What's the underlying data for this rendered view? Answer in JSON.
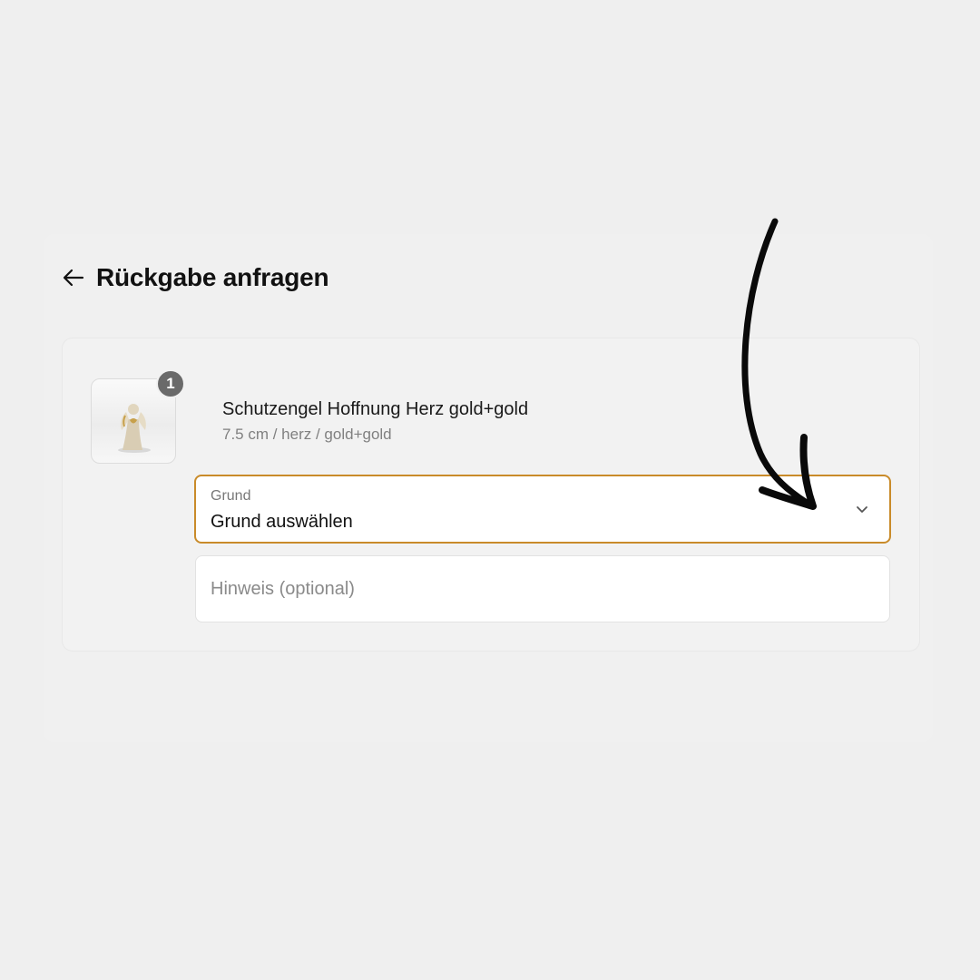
{
  "header": {
    "back_icon": "arrow-left-icon",
    "title": "Rückgabe anfragen"
  },
  "item": {
    "quantity": "1",
    "name": "Schutzengel Hoffnung Herz gold+gold",
    "variant": "7.5 cm / herz / gold+gold"
  },
  "reason_select": {
    "label": "Grund",
    "value": "Grund auswählen",
    "icon": "chevron-down-icon"
  },
  "note_input": {
    "placeholder": "Hinweis (optional)",
    "value": ""
  },
  "colors": {
    "background": "#efefef",
    "accent_border": "#c98b2a",
    "badge": "#6a6a6a"
  }
}
